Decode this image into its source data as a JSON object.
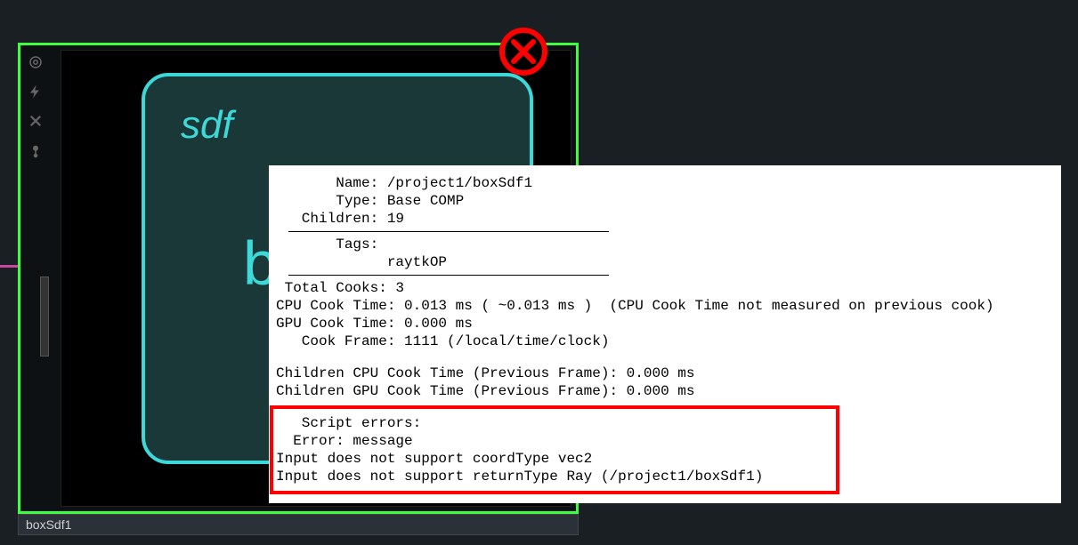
{
  "node": {
    "display_label": "sdf",
    "big_letter": "b",
    "name_bar": "boxSdf1"
  },
  "info": {
    "name_label": "       Name:",
    "name_value": " /project1/boxSdf1",
    "type_label": "       Type:",
    "type_value": " Base COMP",
    "children_label": "   Children:",
    "children_value": " 19",
    "tags_label": "       Tags:",
    "tags_value": "             raytkOP",
    "total_cooks_label": " Total Cooks:",
    "total_cooks_value": " 3",
    "cpu_cook_label": "CPU Cook Time:",
    "cpu_cook_value": " 0.013 ms ( ~0.013 ms )  (CPU Cook Time not measured on previous cook)",
    "gpu_cook_label": "GPU Cook Time:",
    "gpu_cook_value": " 0.000 ms",
    "cook_frame_label": "   Cook Frame:",
    "cook_frame_value": " 1111 (/local/time/clock)",
    "children_cpu": "Children CPU Cook Time (Previous Frame): 0.000 ms",
    "children_gpu": "Children GPU Cook Time (Previous Frame): 0.000 ms",
    "script_errors_label": "   Script errors:",
    "error_message_label": "  Error: message",
    "error_line_1": "Input does not support coordType vec2",
    "error_line_2": "Input does not support returnType Ray (/project1/boxSdf1)"
  }
}
